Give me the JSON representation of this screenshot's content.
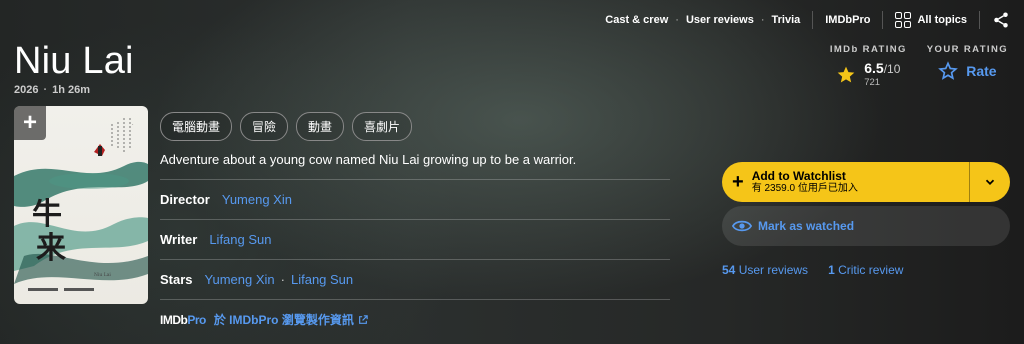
{
  "nav": {
    "cast_crew": "Cast & crew",
    "user_reviews": "User reviews",
    "trivia": "Trivia",
    "imdbpro": "IMDbPro",
    "all_topics": "All topics"
  },
  "title": "Niu Lai",
  "meta": {
    "year": "2026",
    "runtime": "1h 26m"
  },
  "ratings": {
    "imdb_label": "IMDb RATING",
    "score": "6.5",
    "out_of": "/10",
    "votes": "721",
    "your_label": "YOUR RATING",
    "rate_label": "Rate"
  },
  "genres": [
    "電腦動畫",
    "冒險",
    "動畫",
    "喜劇片"
  ],
  "plot": "Adventure about a young cow named Niu Lai growing up to be a warrior.",
  "credits": {
    "director_label": "Director",
    "director": "Yumeng Xin",
    "writer_label": "Writer",
    "writer": "Lifang Sun",
    "stars_label": "Stars",
    "stars": [
      "Yumeng Xin",
      "Lifang Sun"
    ]
  },
  "pro": {
    "logo_a": "IMDb",
    "logo_b": "Pro",
    "text": "於 IMDbPro 瀏覽製作資訊"
  },
  "watchlist": {
    "label": "Add to Watchlist",
    "sub": "有 2359.0 位用戶已加入"
  },
  "watched": {
    "label": "Mark as watched"
  },
  "reviews": {
    "user_count": "54",
    "user_label": "User reviews",
    "critic_count": "1",
    "critic_label": "Critic review"
  },
  "colors": {
    "accent": "#f5c518",
    "link": "#5799ef"
  },
  "poster": {
    "title_glyphs": "牛来",
    "subtitle": "Niu Lai"
  }
}
